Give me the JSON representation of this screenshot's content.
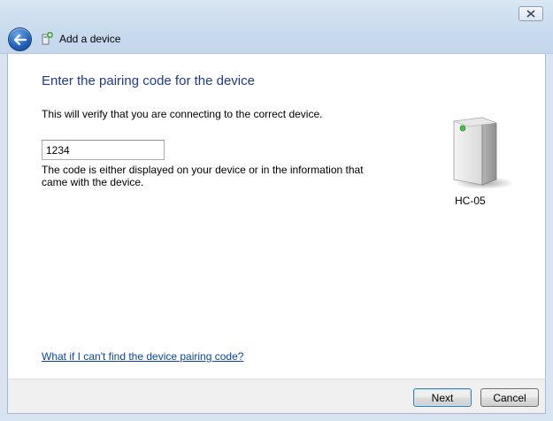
{
  "window": {
    "title": "Add a device"
  },
  "page": {
    "heading": "Enter the pairing code for the device",
    "description": "This will verify that you are connecting to the correct device.",
    "pairing_code": "1234",
    "hint": "The code is either displayed on your device or in the information that came with the device.",
    "help_link": "What if I can't find the device pairing code?"
  },
  "device": {
    "name": "HC-05",
    "icon": "generic-device-icon"
  },
  "footer": {
    "next_label": "Next",
    "cancel_label": "Cancel"
  }
}
